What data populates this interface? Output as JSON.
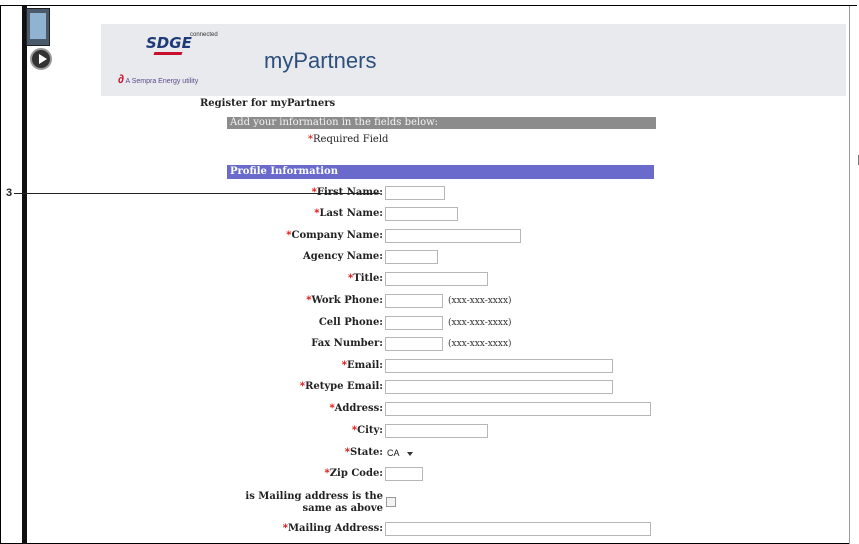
{
  "brand": {
    "logo_text": "SDGE",
    "logo_tag": "connected",
    "parent_company": "A Sempra Energy utility",
    "app_title": "myPartners"
  },
  "page": {
    "heading": "Register for myPartners",
    "instruction": "Add your information in the fields below:",
    "required_star": "*",
    "required_note": "Required Field",
    "section_title": "Profile Information"
  },
  "annotation": {
    "callout_number": "3"
  },
  "form": {
    "first_name": {
      "label": "First Name:",
      "required": true,
      "value": ""
    },
    "last_name": {
      "label": "Last Name:",
      "required": true,
      "value": ""
    },
    "company_name": {
      "label": "Company Name:",
      "required": true,
      "value": ""
    },
    "agency_name": {
      "label": "Agency Name:",
      "required": false,
      "value": ""
    },
    "title": {
      "label": "Title:",
      "required": true,
      "value": ""
    },
    "work_phone": {
      "label": "Work Phone:",
      "required": true,
      "value": "",
      "hint": "(xxx-xxx-xxxx)"
    },
    "cell_phone": {
      "label": "Cell Phone:",
      "required": false,
      "value": "",
      "hint": "(xxx-xxx-xxxx)"
    },
    "fax_number": {
      "label": "Fax Number:",
      "required": false,
      "value": "",
      "hint": "(xxx-xxx-xxxx)"
    },
    "email": {
      "label": "Email:",
      "required": true,
      "value": ""
    },
    "retype_email": {
      "label": "Retype Email:",
      "required": true,
      "value": ""
    },
    "address": {
      "label": "Address:",
      "required": true,
      "value": ""
    },
    "city": {
      "label": "City:",
      "required": true,
      "value": ""
    },
    "state": {
      "label": "State:",
      "required": true,
      "selected": "CA"
    },
    "zip_code": {
      "label": "Zip Code:",
      "required": true,
      "value": ""
    },
    "mailing_same": {
      "label": "is Mailing address is the same as above",
      "checked": false
    },
    "mailing_address": {
      "label": "Mailing Address:",
      "required": true,
      "value": ""
    }
  },
  "colors": {
    "header_bg": "#e9eaed",
    "instruction_bar": "#8c8c8c",
    "section_bar": "#6a6acc",
    "required_star": "#dd0000",
    "title_blue": "#2c4f7c"
  },
  "icons": [
    "video-thumbnail-icon",
    "play-icon",
    "dropdown-caret-icon",
    "sempra-logo-icon"
  ]
}
